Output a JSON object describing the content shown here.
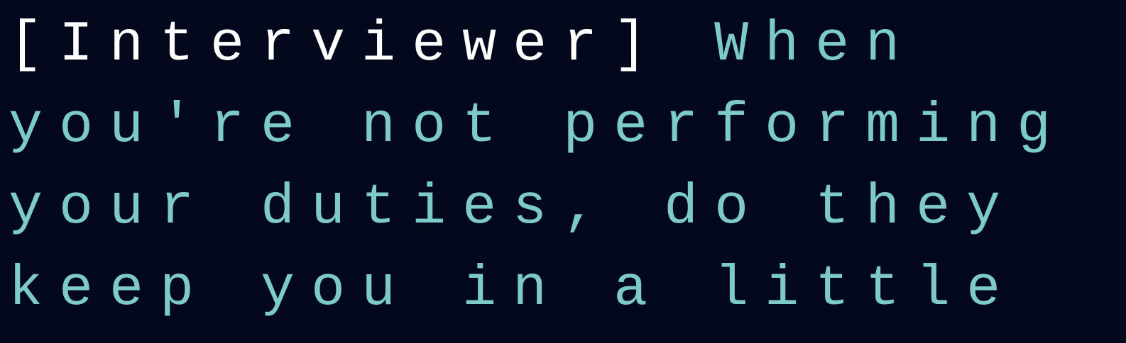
{
  "caption": {
    "speaker_label": "[Interviewer]",
    "line1_rest": "When",
    "line2": "you're not performing",
    "line3": "your duties, do they",
    "line4": "keep you in a little",
    "colors": {
      "background": "#03081c",
      "speaker": "#ffffff",
      "text": "#7ccac9"
    }
  }
}
